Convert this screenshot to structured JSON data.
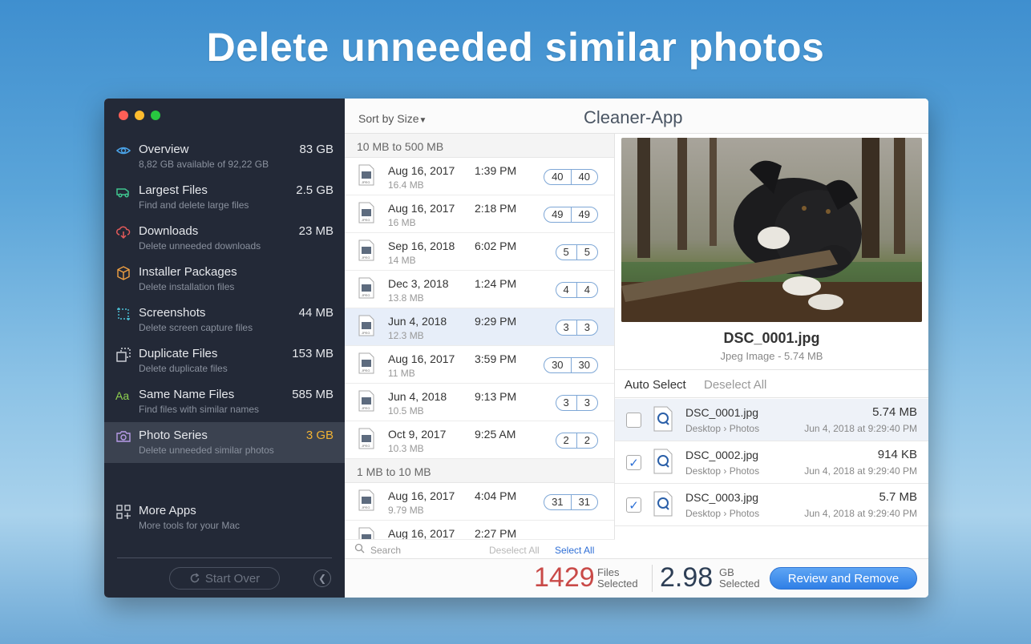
{
  "headline": "Delete unneeded similar photos",
  "app_title": "Cleaner-App",
  "sort_label": "Sort by Size",
  "sidebar": {
    "items": [
      {
        "title": "Overview",
        "sub": "8,82 GB available of 92,22 GB",
        "size": "83 GB",
        "icon": "eye-icon"
      },
      {
        "title": "Largest Files",
        "sub": "Find and delete large files",
        "size": "2.5 GB",
        "icon": "truck-icon"
      },
      {
        "title": "Downloads",
        "sub": "Delete unneeded downloads",
        "size": "23 MB",
        "icon": "cloud-download-icon"
      },
      {
        "title": "Installer Packages",
        "sub": "Delete installation files",
        "size": "",
        "icon": "package-icon"
      },
      {
        "title": "Screenshots",
        "sub": "Delete screen capture files",
        "size": "44 MB",
        "icon": "screenshot-icon"
      },
      {
        "title": "Duplicate Files",
        "sub": "Delete duplicate files",
        "size": "153 MB",
        "icon": "duplicate-icon"
      },
      {
        "title": "Same Name Files",
        "sub": "Find files with similar names",
        "size": "585 MB",
        "icon": "font-icon"
      },
      {
        "title": "Photo Series",
        "sub": "Delete unneeded similar photos",
        "size": "3 GB",
        "icon": "camera-icon"
      }
    ],
    "more": {
      "title": "More Apps",
      "sub": "More tools for your Mac",
      "icon": "apps-grid-icon"
    },
    "start_over": "Start Over"
  },
  "list": {
    "groups": [
      {
        "header": "10 MB to 500 MB",
        "rows": [
          {
            "date": "Aug 16, 2017",
            "size": "16.4 MB",
            "time": "1:39 PM",
            "a": "40",
            "b": "40"
          },
          {
            "date": "Aug 16, 2017",
            "size": "16 MB",
            "time": "2:18 PM",
            "a": "49",
            "b": "49"
          },
          {
            "date": "Sep 16, 2018",
            "size": "14 MB",
            "time": "6:02 PM",
            "a": "5",
            "b": "5"
          },
          {
            "date": "Dec 3, 2018",
            "size": "13.8 MB",
            "time": "1:24 PM",
            "a": "4",
            "b": "4"
          },
          {
            "date": "Jun 4, 2018",
            "size": "12.3 MB",
            "time": "9:29 PM",
            "a": "3",
            "b": "3"
          },
          {
            "date": "Aug 16, 2017",
            "size": "11 MB",
            "time": "3:59 PM",
            "a": "30",
            "b": "30"
          },
          {
            "date": "Jun 4, 2018",
            "size": "10.5 MB",
            "time": "9:13 PM",
            "a": "3",
            "b": "3"
          },
          {
            "date": "Oct 9, 2017",
            "size": "10.3 MB",
            "time": "9:25 AM",
            "a": "2",
            "b": "2"
          }
        ]
      },
      {
        "header": "1 MB to 10 MB",
        "rows": [
          {
            "date": "Aug 16, 2017",
            "size": "9.79 MB",
            "time": "4:04 PM",
            "a": "31",
            "b": "31"
          },
          {
            "date": "Aug 16, 2017",
            "size": "",
            "time": "2:27 PM",
            "a": "",
            "b": ""
          }
        ]
      }
    ],
    "search_placeholder": "Search",
    "deselect_all": "Deselect All",
    "select_all": "Select All"
  },
  "preview": {
    "file_name": "DSC_0001.jpg",
    "file_info": "Jpeg Image - 5.74 MB",
    "auto_select": "Auto Select",
    "deselect_all": "Deselect All",
    "items": [
      {
        "name": "DSC_0001.jpg",
        "folder": "Desktop",
        "sub": "Photos",
        "size": "5.74 MB",
        "date": "Jun 4, 2018 at 9:29:40 PM",
        "checked": false
      },
      {
        "name": "DSC_0002.jpg",
        "folder": "Desktop",
        "sub": "Photos",
        "size": "914 KB",
        "date": "Jun 4, 2018 at 9:29:40 PM",
        "checked": true
      },
      {
        "name": "DSC_0003.jpg",
        "folder": "Desktop",
        "sub": "Photos",
        "size": "5.7 MB",
        "date": "Jun 4, 2018 at 9:29:40 PM",
        "checked": true
      }
    ]
  },
  "footer": {
    "files_count": "1429",
    "files_label_1": "Files",
    "files_label_2": "Selected",
    "gb_count": "2.98",
    "gb_label_1": "GB",
    "gb_label_2": "Selected",
    "review_button": "Review and Remove"
  },
  "colors": {
    "accent": "#2f7fe6",
    "warning": "#f1b233",
    "files_count": "#c94a48"
  }
}
